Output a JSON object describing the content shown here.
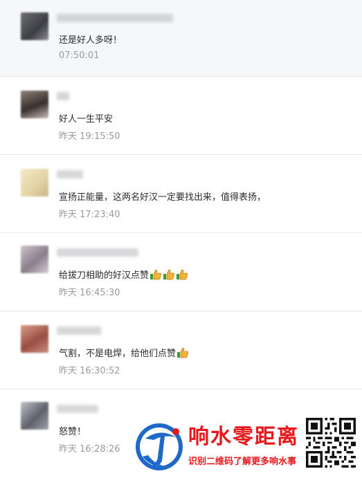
{
  "comments": [
    {
      "text": "还是好人多呀！",
      "time": "07:50:01",
      "thumbs": 0
    },
    {
      "text": "好人一生平安",
      "time": "昨天 19:15:50",
      "thumbs": 0
    },
    {
      "text": "宣扬正能量，这两名好汉一定要找出来，值得表扬，",
      "time": "昨天 17:23:40",
      "thumbs": 0
    },
    {
      "text": "给拔刀相助的好汉点赞",
      "time": "昨天 16:45:30",
      "thumbs": 3
    },
    {
      "text": "气割，不是电焊，给他们点赞",
      "time": "昨天 16:30:52",
      "thumbs": 1
    },
    {
      "text": "怒赞！",
      "time": "昨天 16:28:26",
      "thumbs": 0
    }
  ],
  "watermark": {
    "title": "响水零距离",
    "subtitle": "识别二维码了解更多响水事"
  },
  "colors": {
    "accent_red": "#e8171b",
    "time_gray": "#9a9a9a",
    "highlight_bg": "#f6f7f9",
    "thumb_icon": "thumbs-up-icon"
  }
}
